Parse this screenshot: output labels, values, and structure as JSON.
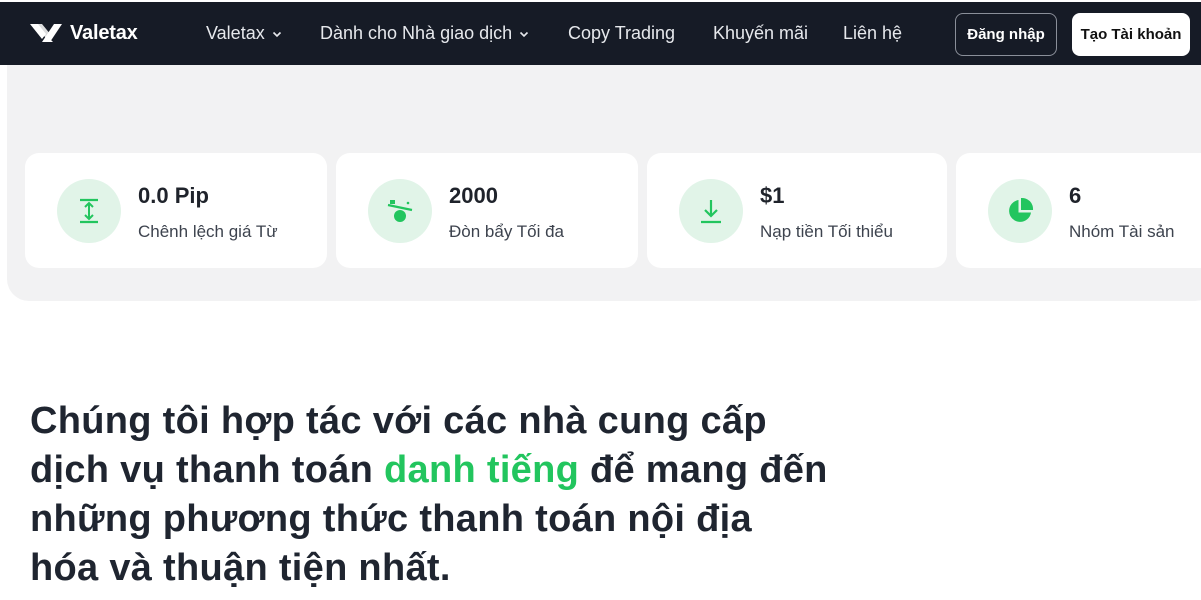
{
  "brand": {
    "name": "Valetax",
    "accent_color": "#22c55e",
    "nav_bg": "#161b26"
  },
  "nav": {
    "items": [
      {
        "label": "Valetax",
        "has_dropdown": true
      },
      {
        "label": "Dành cho Nhà giao dịch",
        "has_dropdown": true
      },
      {
        "label": "Copy Trading",
        "has_dropdown": false
      },
      {
        "label": "Khuyến mãi",
        "has_dropdown": false
      },
      {
        "label": "Liên hệ",
        "has_dropdown": false
      }
    ],
    "login_label": "Đăng nhập",
    "register_label": "Tạo Tài khoản"
  },
  "stats": [
    {
      "icon": "spread-arrows-icon",
      "value": "0.0 Pip",
      "label": "Chênh lệch giá Từ"
    },
    {
      "icon": "leverage-seesaw-icon",
      "value": "2000",
      "label": "Đòn bẩy Tối đa"
    },
    {
      "icon": "download-arrow-icon",
      "value": "$1",
      "label": "Nạp tiền Tối thiểu"
    },
    {
      "icon": "pie-chart-icon",
      "value": "6",
      "label": "Nhóm Tài sản"
    }
  ],
  "headline": {
    "before": "Chúng tôi hợp tác với các nhà cung cấp dịch vụ thanh toán ",
    "highlight": "danh tiếng",
    "after": " để mang đến những phương thức thanh toán nội địa hóa và thuận tiện nhất."
  }
}
